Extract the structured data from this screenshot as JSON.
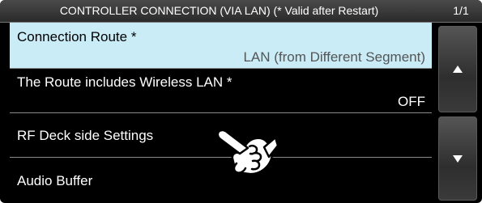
{
  "header": {
    "title": "CONTROLLER CONNECTION (VIA LAN) (* Valid after Restart)",
    "page": "1/1"
  },
  "menu": {
    "items": [
      {
        "label": "Connection Route *",
        "value": "LAN (from Different Segment)",
        "selected": true
      },
      {
        "label": "The Route includes Wireless LAN *",
        "value": "OFF",
        "selected": false
      },
      {
        "label": "RF Deck side Settings",
        "value": "",
        "selected": false
      },
      {
        "label": "Audio Buffer",
        "value": "",
        "selected": false
      }
    ]
  },
  "icons": {
    "scroll_up": "triangle-up-icon",
    "scroll_down": "triangle-down-icon",
    "pointer": "pointing-hand-icon"
  },
  "colors": {
    "selected_background": "#c9ecf6",
    "screen_background": "#000000"
  }
}
